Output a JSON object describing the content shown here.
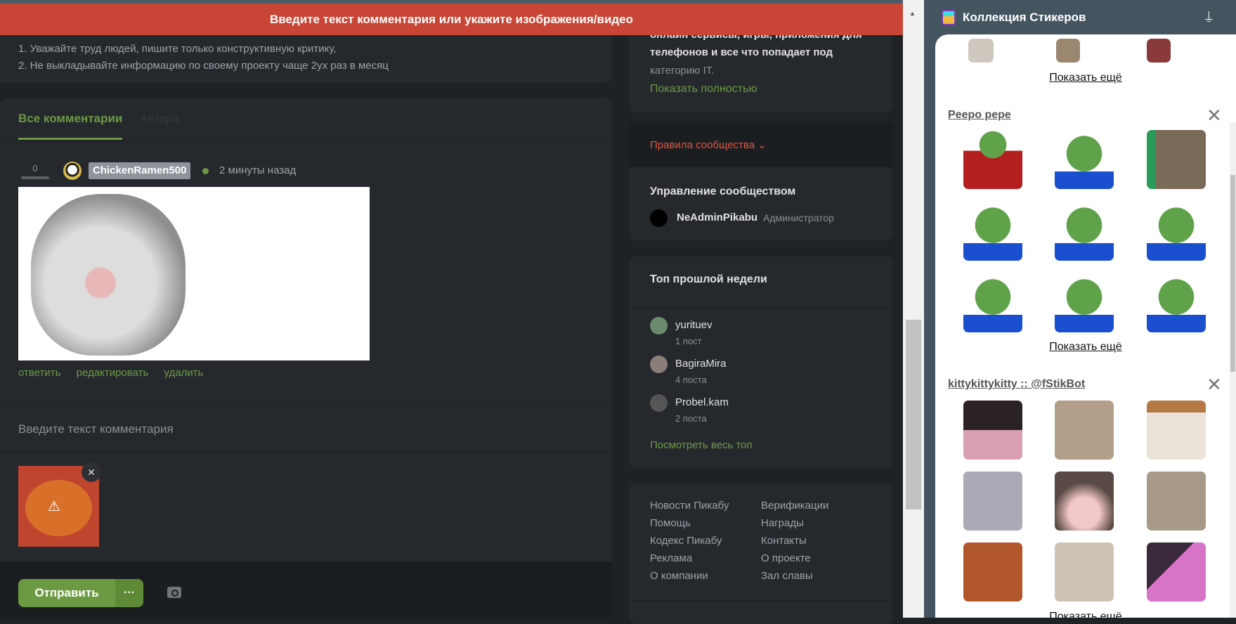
{
  "banner": "Введите текст комментария или укажите изображения/видео",
  "rules": [
    "1. Уважайте труд людей, пишите только конструктивную критику,",
    "2. Не выкладывайте информацию по своему проекту чаще 2ух раз в месяц"
  ],
  "tabs": [
    "Все комментарии",
    "Автора"
  ],
  "comment": {
    "votes": "0",
    "user": "ChickenRamen500",
    "time": "2 минуты назад",
    "actions": [
      "ответить",
      "редактировать",
      "удалить"
    ]
  },
  "input_placeholder": "Введите текст комментария",
  "send_label": "Отправить",
  "more_label": "···",
  "sidebar": {
    "desc": [
      "онлайн сервисы, игры, приложения для",
      "телефонов и все что попадает под",
      "категорию IT."
    ],
    "show_full": "Показать полностью",
    "rules_link": "Правила сообщества ⌄",
    "mgmt_title": "Управление сообществом",
    "admin_name": "NeAdminPikabu",
    "admin_role": "Администратор",
    "top_title": "Топ прошлой недели",
    "top": [
      {
        "name": "yurituev",
        "posts": "1 пост"
      },
      {
        "name": "BagiraMira",
        "posts": "4 поста"
      },
      {
        "name": "Probel.kam",
        "posts": "2 поста"
      }
    ],
    "top_all": "Посмотреть весь топ",
    "footer_col1": [
      "Новости Пикабу",
      "Помощь",
      "Кодекс Пикабу",
      "Реклама",
      "О компании"
    ],
    "footer_col2": [
      "Верификации",
      "Награды",
      "Контакты",
      "О проекте",
      "Зал славы"
    ]
  },
  "stickers": {
    "title": "Коллекция Стикеров",
    "show_more": "Показать ещё",
    "sections": [
      "Peepo pepe",
      "kittykittykitty :: @fStikBot"
    ]
  }
}
